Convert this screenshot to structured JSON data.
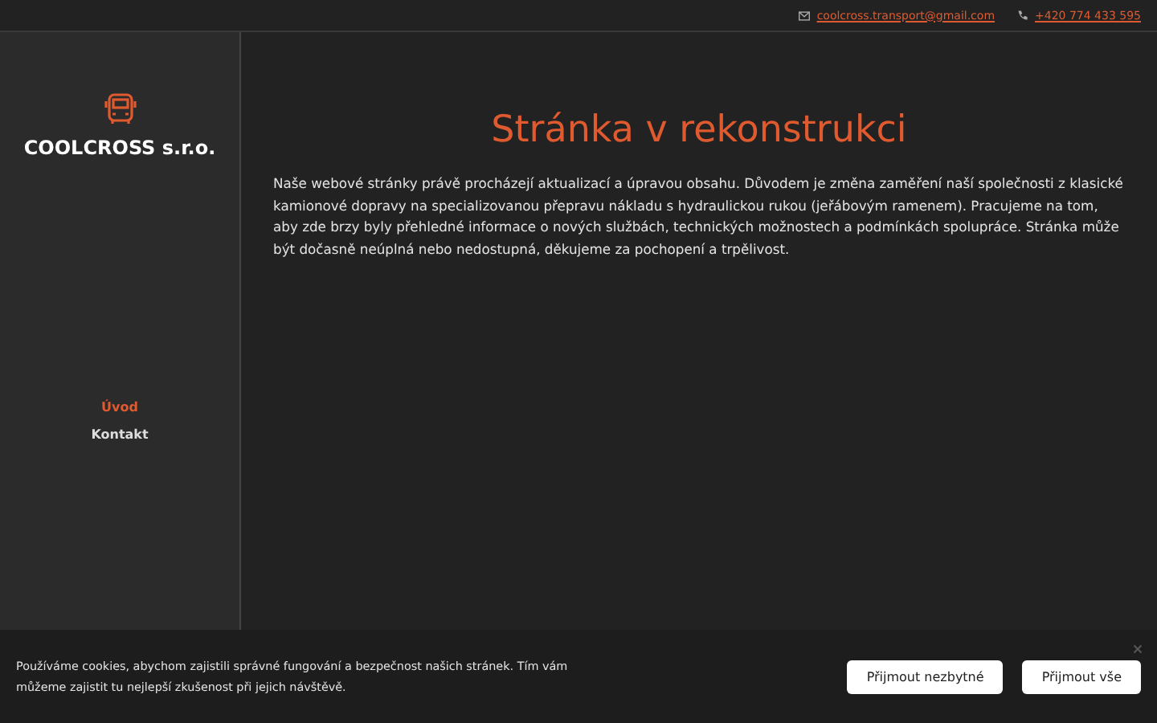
{
  "topbar": {
    "email": "coolcross.transport@gmail.com",
    "phone": "+420 774 433 595"
  },
  "brand": {
    "name": "COOLCROSS s.r.o."
  },
  "nav": [
    {
      "label": "Úvod",
      "selected": true
    },
    {
      "label": "Kontakt",
      "selected": false
    }
  ],
  "main": {
    "heading": "Stránka v rekonstrukci",
    "text": "Naše webové stránky právě procházejí aktualizací a úpravou obsahu. Důvodem je změna zaměření naší společnosti z klasické kamionové dopravy na specializovanou přepravu nákladu s hydraulickou rukou (jeřábovým ramenem). Pracujeme na tom, aby zde brzy byly přehledné informace o nových službách, technických možnostech a podmínkách spolupráce. Stránka může být dočasně neúplná nebo nedostupná, děkujeme za pochopení a trpělivost."
  },
  "cookie_bar": {
    "text": "Používáme cookies, abychom zajistili správné fungování a bezpečnost našich stránek. Tím vám můžeme zajistit tu nejlepší zkušenost při jejich návštěvě.",
    "buttons": [
      "Přijmout nezbytné",
      "Přijmout vše"
    ]
  }
}
